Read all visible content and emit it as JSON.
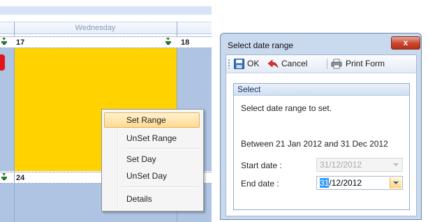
{
  "calendar": {
    "day_header": "Wednesday",
    "rows": [
      {
        "left_number": "17",
        "right_number": "18"
      },
      {
        "left_number": "24"
      }
    ],
    "colors": {
      "selected_fill": "#ffd200",
      "cell_fill": "#aec4e2",
      "accent": "#e3141a"
    }
  },
  "context_menu": {
    "items": [
      {
        "label": "Set Range",
        "highlighted": true
      },
      {
        "label": "UnSet Range"
      },
      {
        "label": "Set Day"
      },
      {
        "label": "UnSet Day"
      },
      {
        "label": "Details"
      }
    ]
  },
  "dialog": {
    "title": "Select date range",
    "close_label": "x",
    "toolbar": {
      "ok_label": "OK",
      "cancel_label": "Cancel",
      "print_label": "Print Form",
      "icons": [
        "save-icon",
        "undo-icon",
        "print-icon"
      ]
    },
    "group": {
      "title": "Select",
      "instruction": "Select date range to set.",
      "range_text": "Between 21 Jan 2012 and 31 Dec 2012",
      "start_label": "Start date :",
      "start_value": "31/12/2012",
      "end_label": "End date :",
      "end_value_selected": "31",
      "end_value_rest": "/12/2012"
    }
  }
}
